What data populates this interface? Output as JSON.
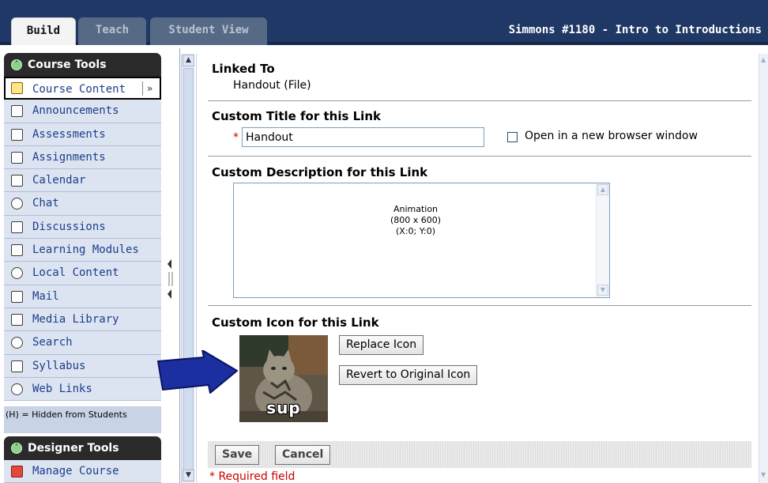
{
  "topbar": {
    "tabs": [
      {
        "label": "Build",
        "active": true
      },
      {
        "label": "Teach",
        "active": false
      },
      {
        "label": "Student View",
        "active": false
      }
    ],
    "course_title": "Simmons #1180 - Intro to Introductions"
  },
  "sidebar": {
    "course_tools_title": "Course Tools",
    "items": [
      {
        "label": "Course Content",
        "icon": "home-icon"
      },
      {
        "label": "Announcements",
        "icon": "megaphone-icon"
      },
      {
        "label": "Assessments",
        "icon": "assessment-icon"
      },
      {
        "label": "Assignments",
        "icon": "assignment-icon"
      },
      {
        "label": "Calendar",
        "icon": "calendar-icon"
      },
      {
        "label": "Chat",
        "icon": "chat-bubble-icon"
      },
      {
        "label": "Discussions",
        "icon": "discussion-pin-icon"
      },
      {
        "label": "Learning Modules",
        "icon": "module-icon"
      },
      {
        "label": "Local Content",
        "icon": "disc-icon"
      },
      {
        "label": "Mail",
        "icon": "mail-icon"
      },
      {
        "label": "Media Library",
        "icon": "media-library-icon"
      },
      {
        "label": "Search",
        "icon": "magnifier-icon"
      },
      {
        "label": "Syllabus",
        "icon": "syllabus-icon"
      },
      {
        "label": "Web Links",
        "icon": "globe-link-icon"
      }
    ],
    "hidden_note": "(H) = Hidden from Students",
    "designer_tools_title": "Designer Tools",
    "designer_items": [
      {
        "label": "Manage Course",
        "icon": "manage-course-icon"
      }
    ]
  },
  "main": {
    "linked_to_label": "Linked To",
    "linked_to_value": "Handout (File)",
    "title_label": "Custom Title for this Link",
    "title_required_marker": "*",
    "title_value": "Handout",
    "new_window_label": "Open in a new browser window",
    "new_window_checked": false,
    "description_label": "Custom Description for this Link",
    "description_preview": {
      "line1": "Animation",
      "line2": "(800 x 600)",
      "line3": "(X:0; Y:0)"
    },
    "icon_label": "Custom Icon for this Link",
    "icon_caption": "sup",
    "replace_icon_label": "Replace Icon",
    "revert_icon_label": "Revert to Original Icon",
    "save_label": "Save",
    "cancel_label": "Cancel",
    "required_note": "* Required field"
  },
  "colors": {
    "topbar_bg": "#1f3865",
    "sidebar_item_bg": "#dde4f1",
    "link_text": "#1a3e8a",
    "required_red": "#cc0000",
    "arrow_blue": "#1b2fa0"
  }
}
